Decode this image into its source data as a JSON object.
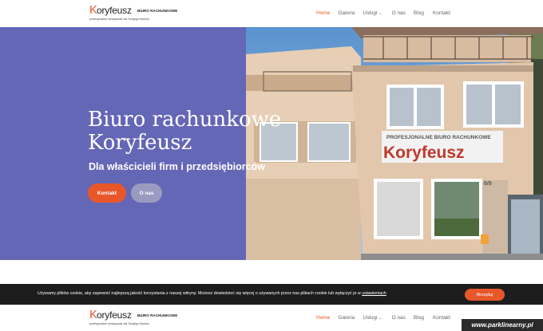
{
  "brand": {
    "logo_initial": "K",
    "logo_rest": "oryfeusz",
    "logo_caption": "BIURO RACHUNKOWE",
    "logo_tagline": "profesjonalne rozwiązanie dla Twojego biznesu"
  },
  "nav": {
    "items": [
      {
        "label": "Home",
        "active": true
      },
      {
        "label": "Galeria"
      },
      {
        "label": "Usługi",
        "has_dropdown": true,
        "dropdown_icon": "chevron-down-icon"
      },
      {
        "label": "O nas"
      },
      {
        "label": "Blog"
      },
      {
        "label": "Kontakt"
      }
    ]
  },
  "hero": {
    "title_line1": "Biuro rachunkowe",
    "title_line2": "Koryfeusz",
    "subtitle": "Dla właścicieli firm i przedsiębiorców",
    "buttons": {
      "kontakt": "Kontakt",
      "onas": "O nas"
    },
    "photo": {
      "sign_top": "PROFESJONALNE BIURO RACHUNKOWE",
      "sign_main": "Koryfeusz",
      "door_number": "6/8"
    }
  },
  "cookie_bar": {
    "text": "Używamy plików cookie, aby zapewnić najlepszą jakość korzystania z naszej witryny. Możesz dowiedzieć się więcej o używanych przez nas plikach cookie lub wyłączyć je w",
    "link": "ustawieniach",
    "accept": "Akceptuj"
  },
  "watermark": "www.parklinearny.pl",
  "colors": {
    "accent": "#e8572a",
    "hero_bg": "#6466b6",
    "secondary_button": "#9a9bc0",
    "cookie_bg": "#1d1d1d"
  }
}
